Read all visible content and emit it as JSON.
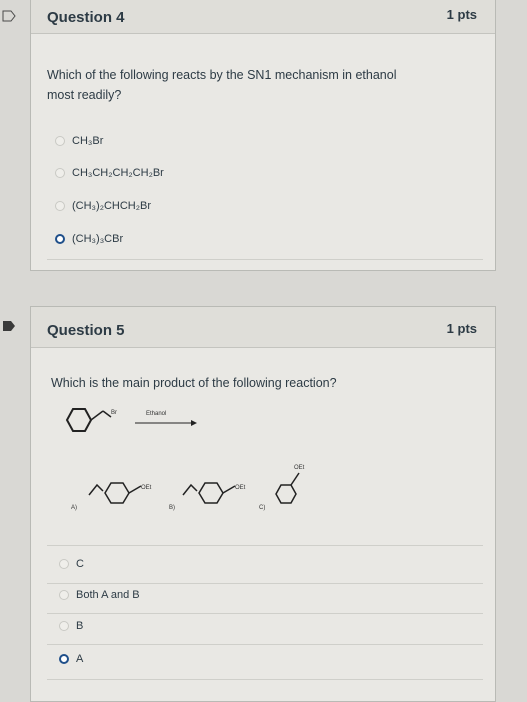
{
  "question4": {
    "title": "Question 4",
    "points": "1 pts",
    "prompt_line1": "Which of the following reacts by the SN1 mechanism in ethanol",
    "prompt_line2": "most readily?",
    "options": [
      {
        "label": "CH₃Br",
        "selected": false
      },
      {
        "label": "CH₃CH₂CH₂CH₂Br",
        "selected": false
      },
      {
        "label": "(CH₃)₂CHCH₂Br",
        "selected": false
      },
      {
        "label": "(CH₃)₃CBr",
        "selected": true
      }
    ]
  },
  "question5": {
    "title": "Question 5",
    "points": "1 pts",
    "prompt": "Which is the main product of the following reaction?",
    "reaction": {
      "substituent": "Br",
      "reagent": "Ethanol",
      "product_group": "OEt",
      "choice_labels": [
        "A)",
        "B)",
        "C)"
      ]
    },
    "options": [
      {
        "label": "C",
        "selected": false
      },
      {
        "label": "Both A and B",
        "selected": false
      },
      {
        "label": "B",
        "selected": false
      },
      {
        "label": "A",
        "selected": true
      }
    ]
  },
  "colors": {
    "selected_radio": "#1f4f8a",
    "flag_q5": "#3a3a3a"
  }
}
